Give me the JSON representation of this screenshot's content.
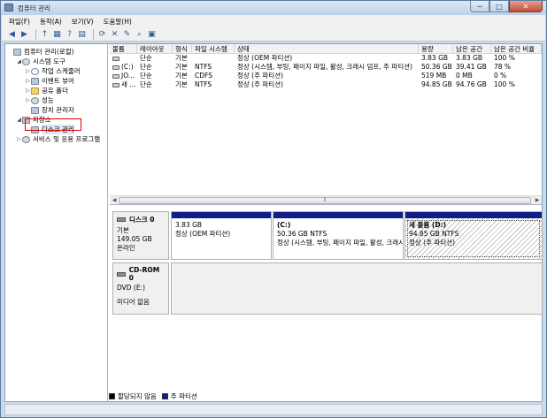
{
  "window": {
    "title": "컴퓨터 관리"
  },
  "controls": {
    "minimize": "─",
    "maximize": "□",
    "close": "✕"
  },
  "menu": [
    "파일(F)",
    "동작(A)",
    "보기(V)",
    "도움말(H)"
  ],
  "toolbar_icons": [
    "back-icon",
    "forward-icon",
    "up-folder-icon",
    "show-tree-icon",
    "help-icon",
    "properties-icon",
    "refresh-icon",
    "delete-icon",
    "open-icon",
    "search-icon",
    "view-icon"
  ],
  "toolbar_glyphs": [
    "◀",
    "▶",
    "↑",
    "▦",
    "?",
    "▤",
    "⟳",
    "✕",
    "✎",
    "⌕",
    "▣"
  ],
  "tree": [
    {
      "label": "컴퓨터 관리(로컬)",
      "level": 0,
      "expander": "",
      "icon": "computer"
    },
    {
      "label": "시스템 도구",
      "level": 1,
      "expander": "◢",
      "icon": "gear"
    },
    {
      "label": "작업 스케줄러",
      "level": 2,
      "expander": "▷",
      "icon": "clock"
    },
    {
      "label": "이벤트 뷰어",
      "level": 2,
      "expander": "▷",
      "icon": "computer"
    },
    {
      "label": "공유 폴더",
      "level": 2,
      "expander": "▷",
      "icon": "folder"
    },
    {
      "label": "성능",
      "level": 2,
      "expander": "▷",
      "icon": "gear"
    },
    {
      "label": "장치 관리자",
      "level": 2,
      "expander": "",
      "icon": "computer"
    },
    {
      "label": "저장소",
      "level": 1,
      "expander": "◢",
      "icon": "disk"
    },
    {
      "label": "디스크 관리",
      "level": 2,
      "expander": "",
      "icon": "disk",
      "selected": true
    },
    {
      "label": "서비스 및 응용 프로그램",
      "level": 1,
      "expander": "▷",
      "icon": "gear"
    }
  ],
  "volumes": {
    "columns": [
      "볼륨",
      "레이아웃",
      "형식",
      "파일 시스템",
      "상태",
      "용량",
      "남은 공간",
      "남은 공간 비율"
    ],
    "rows": [
      [
        "",
        "단순",
        "기본",
        "",
        "정상 (OEM 파티션)",
        "3.83 GB",
        "3.83 GB",
        "100 %"
      ],
      [
        "(C:)",
        "단순",
        "기본",
        "NTFS",
        "정상 (시스템, 부팅, 페이지 파일, 활성, 크래시 덤프, 주 파티션)",
        "50.36 GB",
        "39.41 GB",
        "78 %"
      ],
      [
        "JO...",
        "단순",
        "기본",
        "CDFS",
        "정상 (주 파티션)",
        "519 MB",
        "0 MB",
        "0 %"
      ],
      [
        "새 ...",
        "단순",
        "기본",
        "NTFS",
        "정상 (주 파티션)",
        "94.85 GB",
        "94.76 GB",
        "100 %"
      ]
    ],
    "scroll_thumb": "⦀",
    "scroll_left": "◀",
    "scroll_right": "▶"
  },
  "disks": [
    {
      "name": "디스크 0",
      "type": "기본",
      "size": "149.05 GB",
      "status": "온라인",
      "partitions": [
        {
          "name": "",
          "size": "3.83 GB",
          "status": "정상 (OEM 파티션)"
        },
        {
          "name": "(C:)",
          "size": "50.36 GB NTFS",
          "status": "정상 (시스템, 부팅, 페이지 파일, 활성, 크래시"
        },
        {
          "name": "새 볼륨  (D:)",
          "size": "94.85 GB NTFS",
          "status": "정상 (주 파티션)"
        }
      ]
    },
    {
      "name": "CD-ROM 0",
      "type": "DVD (E:)",
      "size": "",
      "status": "미디어 없음",
      "partitions": []
    }
  ],
  "legend": [
    {
      "label": "할당되지 않음",
      "color": "#000000"
    },
    {
      "label": "주 파티션",
      "color": "#0f1d86"
    }
  ],
  "colors": {
    "primary_partition": "#0f1d86",
    "selection_box": "#e00000",
    "titlebar": "#c9d9ea"
  }
}
